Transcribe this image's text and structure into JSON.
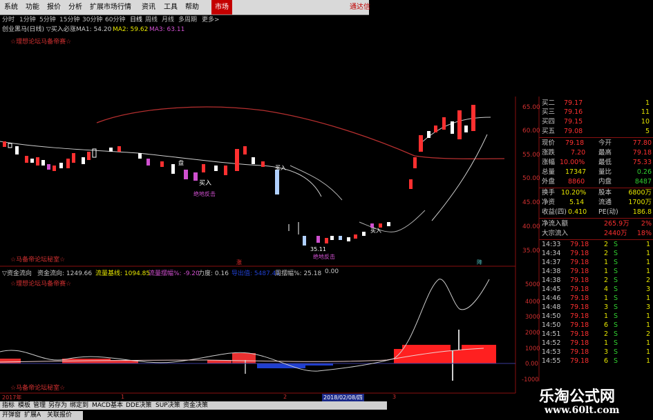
{
  "menu": {
    "items": [
      "系统",
      "功能",
      "报价",
      "分析",
      "扩展市场行情",
      "资讯",
      "工具",
      "帮助"
    ],
    "market": "市场",
    "right": "通达信"
  },
  "periods": {
    "items": [
      "分时",
      "1分钟",
      "5分钟",
      "15分钟",
      "30分钟",
      "60分钟",
      "日线",
      "周线",
      "月线",
      "多周期",
      "更多>"
    ],
    "active_index": 6
  },
  "info": {
    "title": "创业黑马(日线) ▽买入必涨",
    "ma1_label": "MA1: 54.20",
    "ma2_label": "MA2: 59.62",
    "ma3_label": "MA3: 63.11"
  },
  "main_chart": {
    "top_note": "☆理想论坛马备帝赛☆",
    "bottom_note": "☆马备帝论坛秘室☆",
    "y_ticks": [
      "65.00",
      "60.00",
      "55.00",
      "50.00",
      "45.00",
      "40.00",
      "35.00"
    ],
    "annotations": {
      "buy1": "买入",
      "buy2": "买入",
      "buy3": "买入",
      "low_price": "35.11",
      "bottom_tag1": "绝地反击",
      "bottom_tag2": "绝地反击",
      "rise_marker": "涨",
      "fall_marker": "降",
      "plate1": "盘"
    },
    "colors": {
      "up": "#ff3030",
      "down": "#ffffff",
      "ma_red": "#c43030",
      "ma_white": "#cfcfcf",
      "ma_blue": "#8fb3c8"
    }
  },
  "indicator": {
    "title": "▽资金流向",
    "flow_label": "资金流向: 1249.66",
    "base_label": "流量基线: 1094.85",
    "amp_label": "流量摆幅%: -9.20",
    "force_label": "力度: 0.16",
    "hidden_label": "导出值: 5487.41",
    "week_label": "周摆幅%: 25.18",
    "zero_label": "0.00",
    "top_note": "☆理想论坛马备帝赛☆",
    "bottom_note": "☆马备帝论坛秘室☆",
    "y_ticks": [
      "5000",
      "4000",
      "3000",
      "2000",
      "1000",
      "0.00",
      "-1000"
    ]
  },
  "timebar": {
    "year": "2017年",
    "m1": "1",
    "m2": "2",
    "date": "2018/02/08/四",
    "m3": "3"
  },
  "tabs": {
    "items": [
      "指标",
      "模板",
      "管理",
      "另存为",
      "绑定到",
      "MACD基本",
      "DDE决策",
      "SUP决策",
      "资金决策"
    ],
    "row2": [
      "开弹窗",
      "扩展A",
      "关联报价"
    ]
  },
  "quote": {
    "bids": [
      {
        "label": "买二",
        "price": "79.17",
        "vol": "1"
      },
      {
        "label": "买三",
        "price": "79.16",
        "vol": "11"
      },
      {
        "label": "买四",
        "price": "79.15",
        "vol": "10"
      },
      {
        "label": "买五",
        "price": "79.08",
        "vol": "5"
      }
    ],
    "stats": [
      {
        "l1": "现价",
        "v1": "79.18",
        "l2": "今开",
        "v2": "77.80"
      },
      {
        "l1": "涨跌",
        "v1": "7.20",
        "l2": "最高",
        "v2": "79.18"
      },
      {
        "l1": "涨幅",
        "v1": "10.00%",
        "l2": "最低",
        "v2": "75.33"
      },
      {
        "l1": "总量",
        "v1": "17347",
        "l2": "量比",
        "v2": "0.26"
      },
      {
        "l1": "外盘",
        "v1": "8860",
        "l2": "内盘",
        "v2": "8487"
      },
      {
        "l1": "换手",
        "v1": "10.20%",
        "l2": "股本",
        "v2": "6800万"
      },
      {
        "l1": "净资",
        "v1": "5.14",
        "l2": "流通",
        "v2": "1700万"
      },
      {
        "l1": "收益(四)",
        "v1": "0.410",
        "l2": "PE(动)",
        "v2": "186.8"
      }
    ],
    "flows": [
      {
        "label": "净流入额",
        "value": "265.9万",
        "pct": "2%"
      },
      {
        "label": "大宗流入",
        "value": "2440万",
        "pct": "18%"
      }
    ],
    "ticks": [
      {
        "time": "14:33",
        "price": "79.18",
        "vol": "2",
        "side": "S",
        "n": "1"
      },
      {
        "time": "14:34",
        "price": "79.18",
        "vol": "2",
        "side": "S",
        "n": "1"
      },
      {
        "time": "14:37",
        "price": "79.18",
        "vol": "1",
        "side": "S",
        "n": "1"
      },
      {
        "time": "14:38",
        "price": "79.18",
        "vol": "1",
        "side": "S",
        "n": "1"
      },
      {
        "time": "14:38",
        "price": "79.18",
        "vol": "2",
        "side": "S",
        "n": "2"
      },
      {
        "time": "14:45",
        "price": "79.18",
        "vol": "4",
        "side": "S",
        "n": "3"
      },
      {
        "time": "14:46",
        "price": "79.18",
        "vol": "1",
        "side": "S",
        "n": "1"
      },
      {
        "time": "14:48",
        "price": "79.18",
        "vol": "3",
        "side": "S",
        "n": "3"
      },
      {
        "time": "14:50",
        "price": "79.18",
        "vol": "1",
        "side": "S",
        "n": "1"
      },
      {
        "time": "14:50",
        "price": "79.18",
        "vol": "6",
        "side": "S",
        "n": "1"
      },
      {
        "time": "14:51",
        "price": "79.18",
        "vol": "2",
        "side": "S",
        "n": "2"
      },
      {
        "time": "14:52",
        "price": "79.18",
        "vol": "1",
        "side": "S",
        "n": "1"
      },
      {
        "time": "14:53",
        "price": "79.18",
        "vol": "3",
        "side": "S",
        "n": "1"
      },
      {
        "time": "14:55",
        "price": "79.18",
        "vol": "6",
        "side": "S",
        "n": "1"
      }
    ]
  },
  "watermark": {
    "line1": "乐淘公式网",
    "line2": "www.60lt.com"
  }
}
